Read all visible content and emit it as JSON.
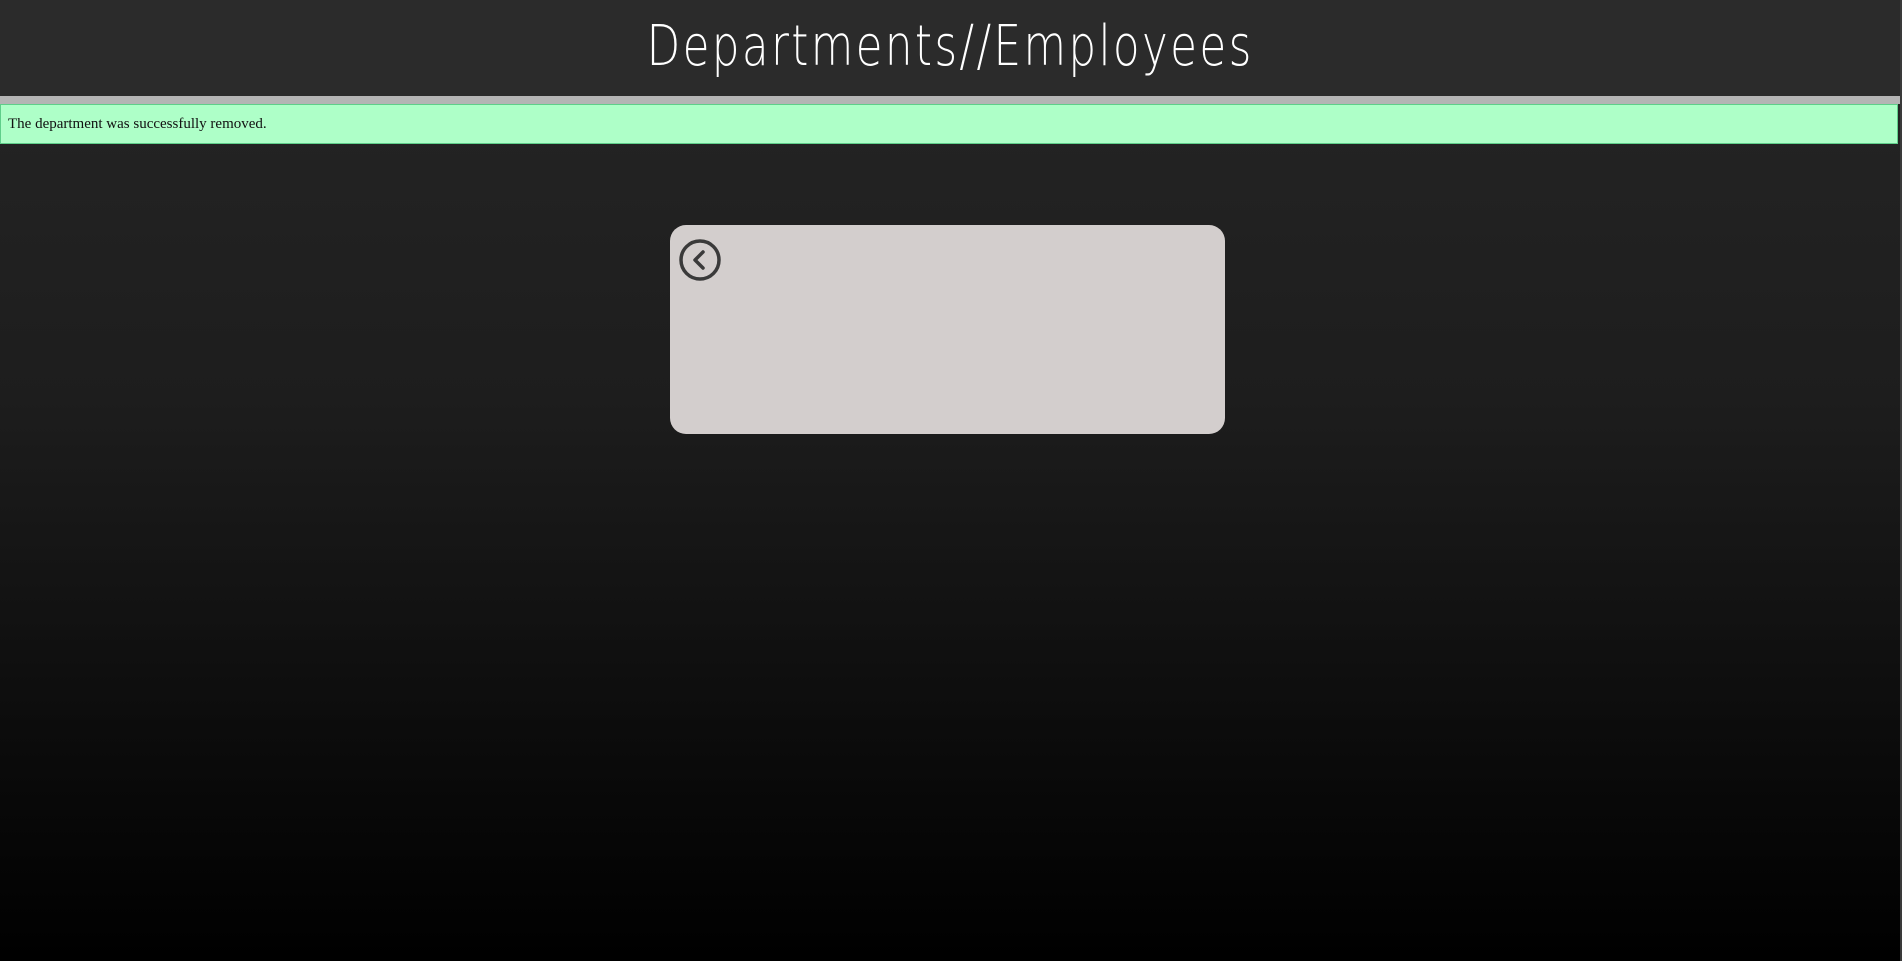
{
  "header": {
    "title": "Departments//Employees"
  },
  "flash": {
    "message": "The department was successfully removed."
  },
  "card": {
    "back_icon": "chevron-left-circle-icon"
  },
  "colors": {
    "header_bg": "#2b2b2b",
    "rule": "#b4b4b4",
    "success_bg": "#aeffc8",
    "card_bg": "#d3cecd",
    "icon": "#3a3a3a"
  }
}
